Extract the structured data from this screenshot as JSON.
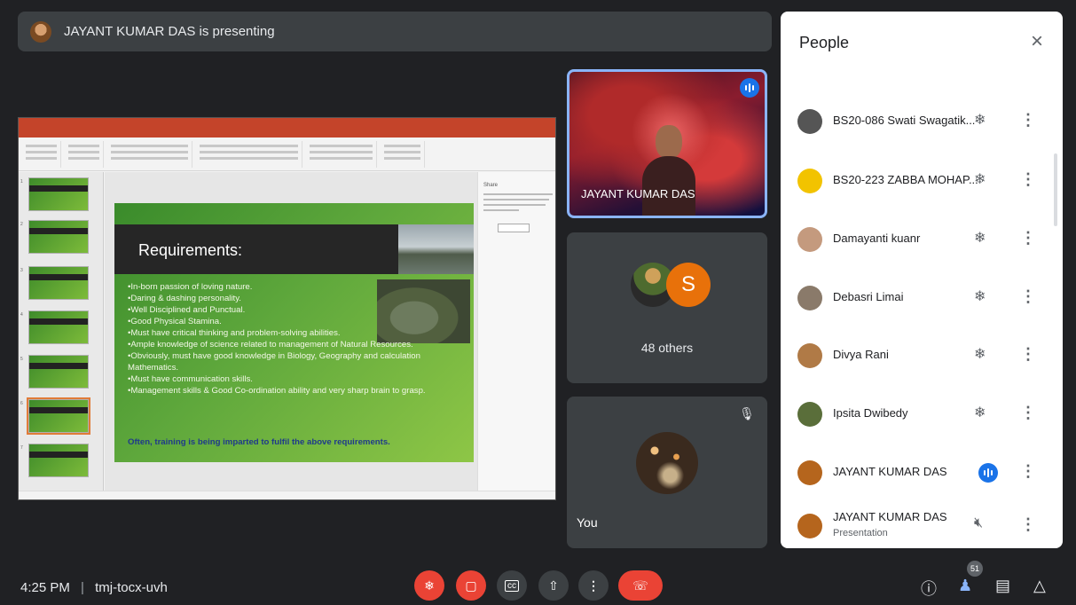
{
  "banner": {
    "text": "JAYANT KUMAR DAS is presenting"
  },
  "slide": {
    "title": "Requirements:",
    "bullets": [
      "In-born passion of loving nature.",
      "Daring & dashing personality.",
      "Well Disciplined and Punctual.",
      "Good Physical Stamina.",
      "Must have critical thinking and problem-solving abilities.",
      "Ample knowledge of science related to management of Natural Resources.",
      "Obviously, must have good knowledge in Biology, Geography and calculation Mathematics.",
      "Must have communication skills.",
      "Management skills & Good Co-ordination ability and very sharp brain to grasp."
    ],
    "footer": "Often, training is being imparted to fulfil the above requirements.",
    "pane_title": "Share"
  },
  "tiles": {
    "presenter_name": "JAYANT KUMAR DAS",
    "others_avatar_letter": "S",
    "others_label": "48 others",
    "self_label": "You"
  },
  "people": {
    "title": "People",
    "close": "×",
    "rows": [
      {
        "name": "BS20-086 Swati Swagatik...",
        "sub": "",
        "avatar_color": "#555555",
        "mic": "muted"
      },
      {
        "name": "BS20-223 ZABBA MOHAP...",
        "sub": "",
        "avatar_color": "#f2c300",
        "mic": "muted"
      },
      {
        "name": "Damayanti kuanr",
        "sub": "",
        "avatar_color": "#c49a7e",
        "mic": "muted"
      },
      {
        "name": "Debasri Limai",
        "sub": "",
        "avatar_color": "#8a7a6a",
        "mic": "muted"
      },
      {
        "name": "Divya Rani",
        "sub": "",
        "avatar_color": "#b07a46",
        "mic": "muted"
      },
      {
        "name": "Ipsita Dwibedy",
        "sub": "",
        "avatar_color": "#5a6e3a",
        "mic": "muted"
      },
      {
        "name": "JAYANT KUMAR DAS",
        "sub": "",
        "avatar_color": "#b5651d",
        "mic": "speaking"
      },
      {
        "name": "JAYANT KUMAR DAS",
        "sub": "Presentation",
        "avatar_color": "#b5651d",
        "mic": "audio-off"
      }
    ]
  },
  "bottom": {
    "time": "4:25 PM",
    "separator": "|",
    "meeting_code": "tmj-tocx-uvh",
    "people_count": "51"
  }
}
